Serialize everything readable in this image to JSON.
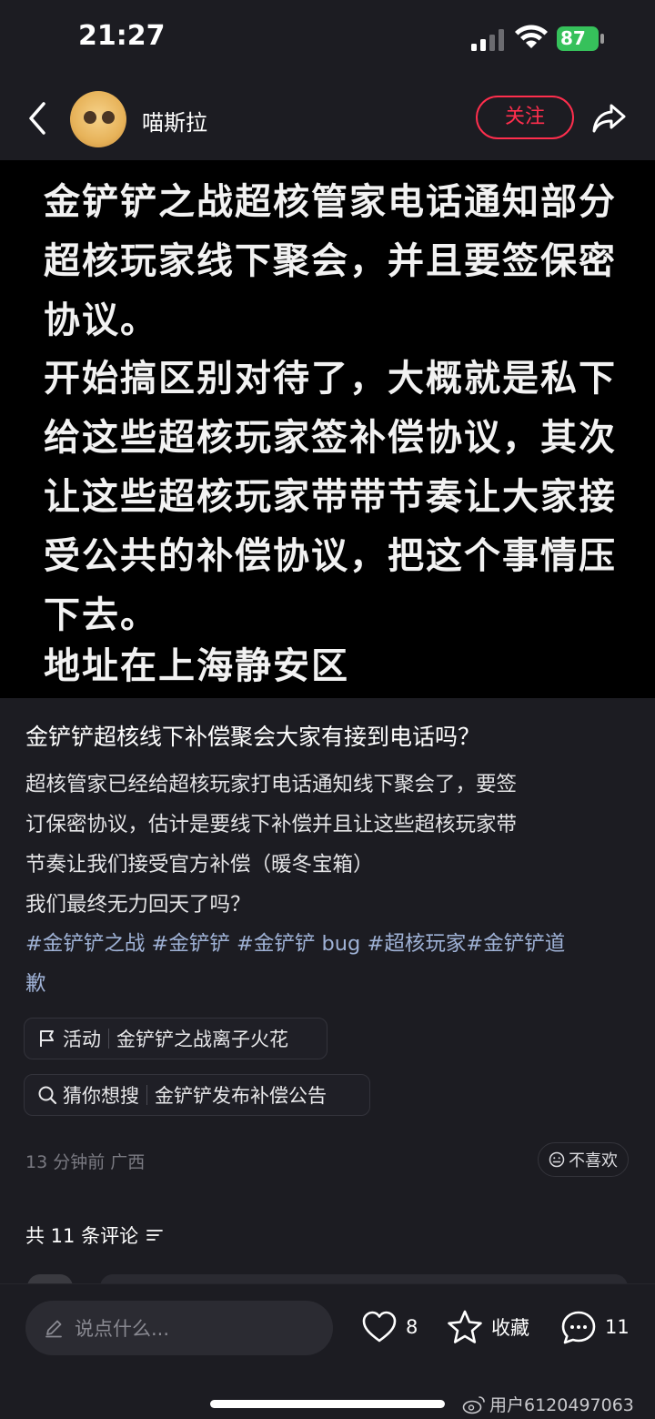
{
  "status": {
    "time": "21:27",
    "battery": "87"
  },
  "header": {
    "author": "喵斯拉",
    "follow_label": "关注"
  },
  "hero": {
    "paragraphs": [
      "金铲铲之战超核管家电话通知部分超核玩家线下聚会，并且要签保密协议。",
      "开始搞区别对待了，大概就是私下给这些超核玩家签补偿协议，其次让这些超核玩家带带节奏让大家接受公共的补偿协议，把这个事情压下去。",
      "地址在上海静安区"
    ]
  },
  "post": {
    "title": "金铲铲超核线下补偿聚会大家有接到电话吗？",
    "body_lines": [
      "超核管家已经给超核玩家打电话通知线下聚会了，要签",
      "订保密协议，估计是要线下补偿并且让这些超核玩家带",
      "节奏让我们接受官方补偿（暖冬宝箱）",
      "我们最终无力回天了吗？"
    ],
    "tags": [
      "#金铲铲之战",
      "#金铲铲",
      "#金铲铲bug",
      "#超核玩家",
      "#金铲铲道歉"
    ],
    "tags_line1": "#金铲铲之战 #金铲铲 #金铲铲 bug #超核玩家#金铲铲道",
    "tags_line2": "歉",
    "activity": {
      "label": "活动",
      "value": "金铲铲之战离子火花"
    },
    "search": {
      "label": "猜你想搜",
      "value": "金铲铲发布补偿公告"
    },
    "meta": "13 分钟前  广西",
    "dislike_label": "不喜欢"
  },
  "comments": {
    "header": "共 11 条评论"
  },
  "bottom": {
    "input_placeholder": "说点什么...",
    "like_count": "8",
    "collect_label": "收藏",
    "comment_count": "11",
    "watermark": "用户6120497063"
  },
  "colors": {
    "accent": "#ff2e4d",
    "battery": "#36c15b",
    "tag": "#9fb2d6"
  }
}
